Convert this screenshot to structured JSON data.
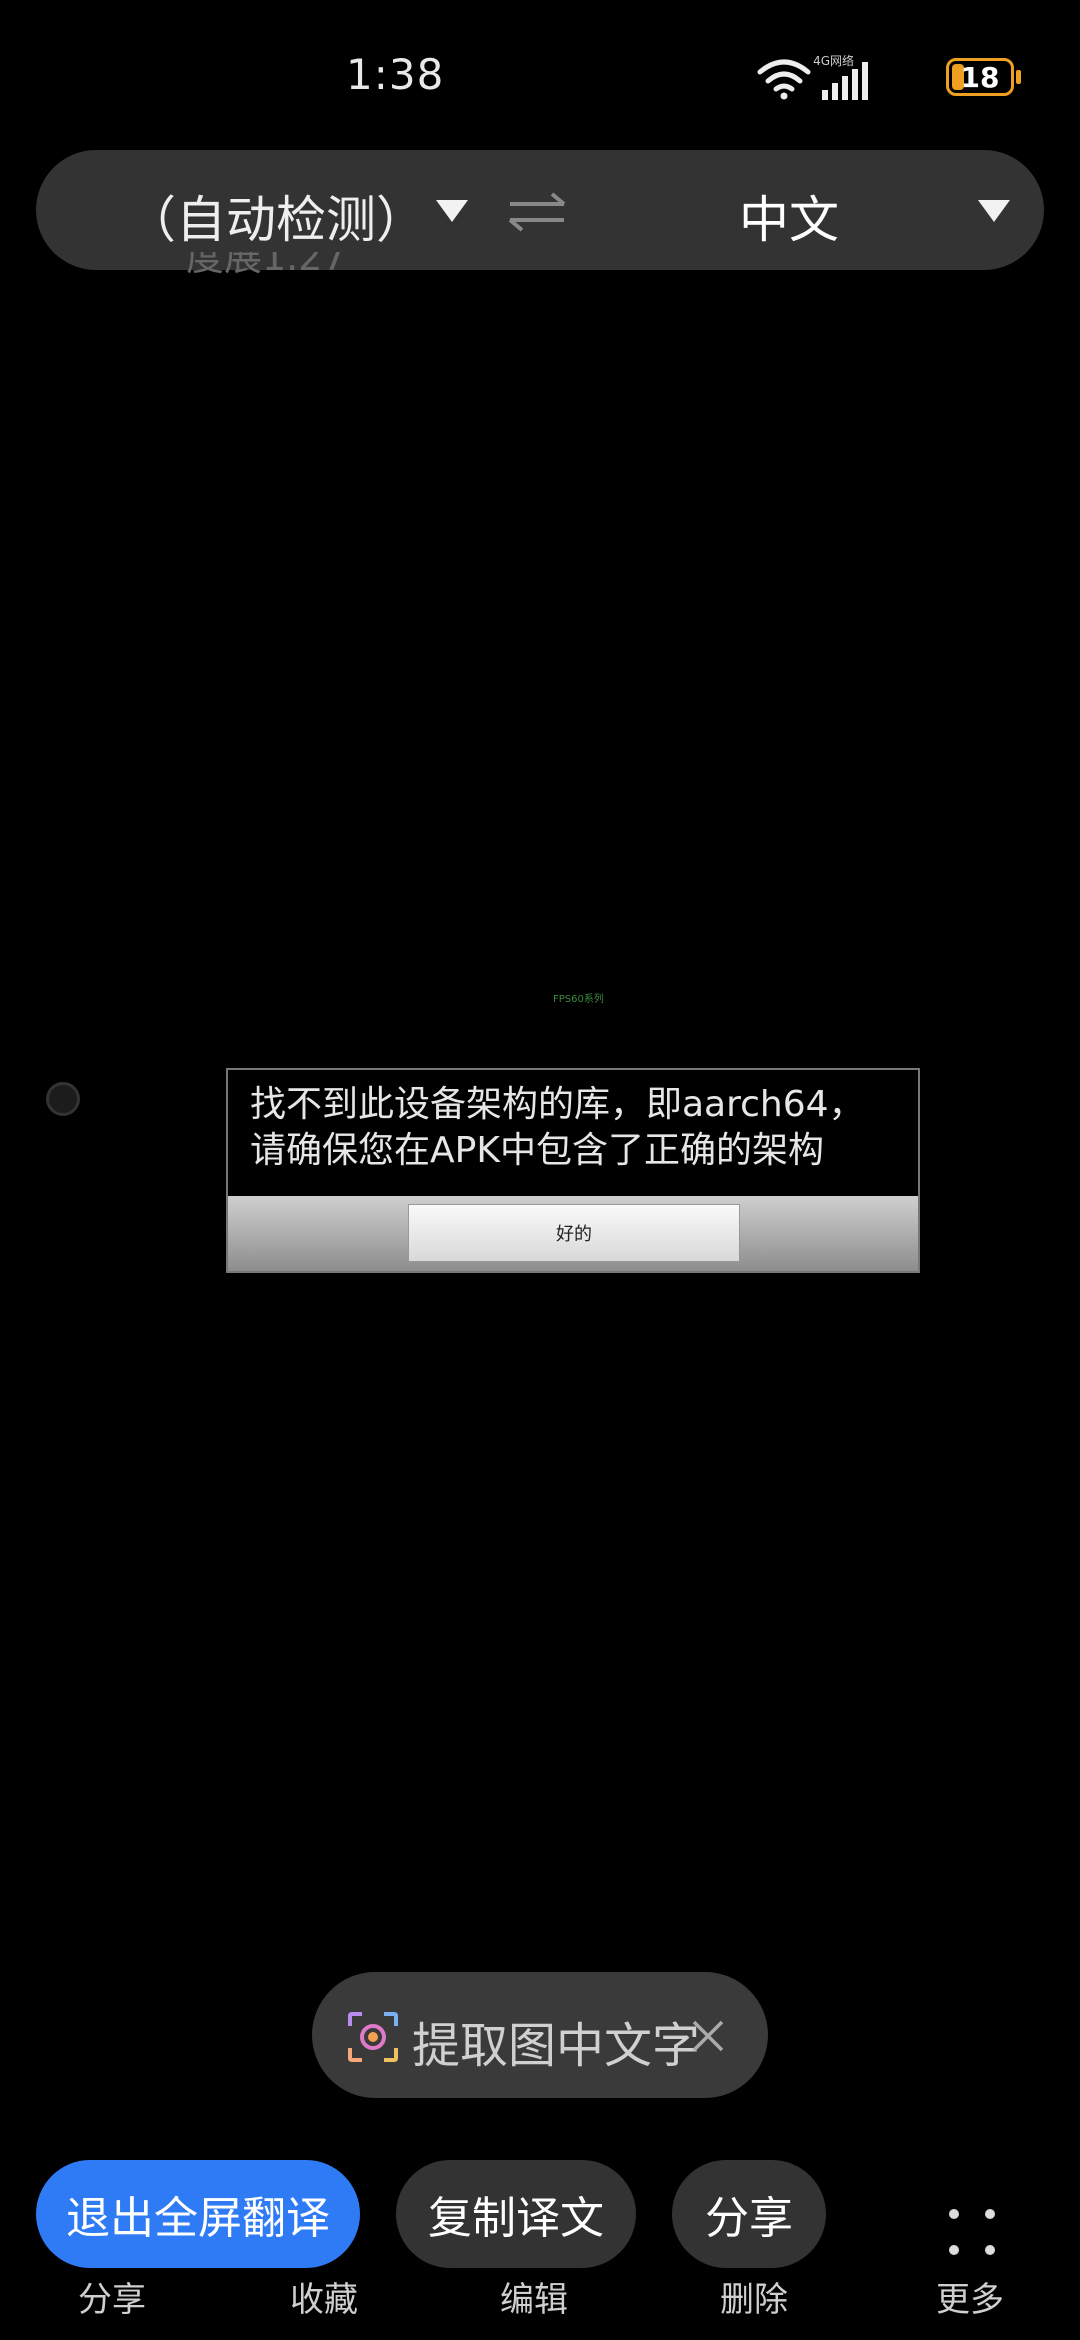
{
  "status_bar": {
    "time": "1:38",
    "network_label": "4G网络",
    "battery": "18"
  },
  "lang_bar": {
    "source_lang": "（自动检测）",
    "target_lang": "中文"
  },
  "background": {
    "partial_text": "度展1.27",
    "tiny_label": "FPS60系列"
  },
  "dialog": {
    "message": "找不到此设备架构的库，即aarch64，请确保您在APK中包含了正确的架构",
    "ok_label": "好的"
  },
  "extract": {
    "label": "提取图中文字"
  },
  "actions": {
    "exit_fullscreen": "退出全屏翻译",
    "copy_translation": "复制译文",
    "share": "分享"
  },
  "bottom_toolbar": {
    "share": "分享",
    "favorite": "收藏",
    "edit": "编辑",
    "delete": "删除",
    "more": "更多"
  },
  "colors": {
    "accent": "#2f7bf6",
    "battery": "#f0a020",
    "background": "#000000"
  }
}
